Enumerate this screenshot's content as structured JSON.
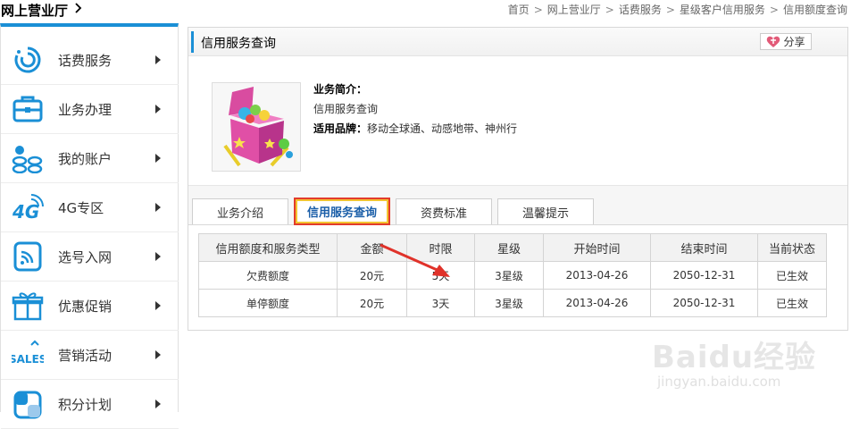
{
  "header": {
    "title": "网上营业厅",
    "breadcrumb": [
      "首页",
      "网上营业厅",
      "话费服务",
      "星级客户信用服务",
      "信用额度查询"
    ]
  },
  "sidebar": {
    "items": [
      {
        "label": "话费服务",
        "icon": "refresh-circle-icon"
      },
      {
        "label": "业务办理",
        "icon": "briefcase-icon"
      },
      {
        "label": "我的账户",
        "icon": "account-icon"
      },
      {
        "label": "4G专区",
        "icon": "4g-icon"
      },
      {
        "label": "选号入网",
        "icon": "sim-signal-icon"
      },
      {
        "label": "优惠促销",
        "icon": "gift-icon"
      },
      {
        "label": "营销活动",
        "icon": "sales-icon"
      },
      {
        "label": "积分计划",
        "icon": "points-icon"
      }
    ]
  },
  "panel": {
    "title": "信用服务查询",
    "share_label": "分享",
    "intro_label": "业务简介：",
    "intro_text": "信用服务查询",
    "brand_label": "适用品牌：",
    "brand_text": "移动全球通、动感地带、神州行"
  },
  "tabs": [
    {
      "label": "业务介绍",
      "active": false
    },
    {
      "label": "信用服务查询",
      "active": true
    },
    {
      "label": "资费标准",
      "active": false
    },
    {
      "label": "温馨提示",
      "active": false
    }
  ],
  "table": {
    "headers": [
      "信用额度和服务类型",
      "金额",
      "时限",
      "星级",
      "开始时间",
      "结束时间",
      "当前状态"
    ],
    "rows": [
      [
        "欠费额度",
        "20元",
        "5天",
        "3星级",
        "2013-04-26",
        "2050-12-31",
        "已生效"
      ],
      [
        "单停额度",
        "20元",
        "3天",
        "3星级",
        "2013-04-26",
        "2050-12-31",
        "已生效"
      ]
    ]
  },
  "watermark": {
    "main": "Baidu经验",
    "sub": "jingyan.baidu.com"
  },
  "colors": {
    "accent": "#1a8fd6",
    "highlight_border": "#e23b2b",
    "arrow": "#e0322a"
  }
}
